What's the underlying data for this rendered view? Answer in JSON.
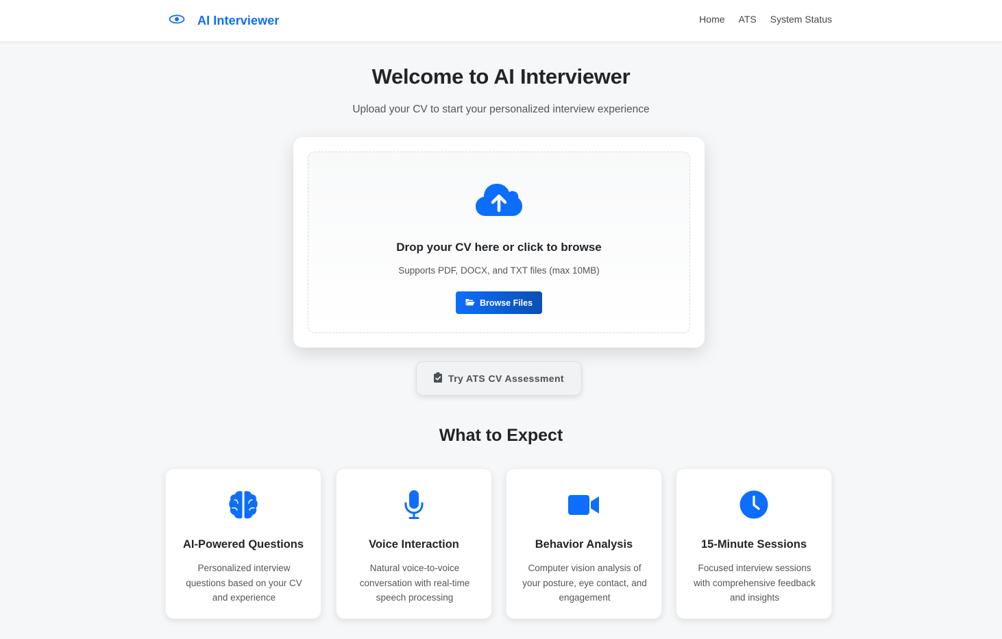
{
  "colors": {
    "accent": "#0d6efd",
    "accent_dark": "#0a4fb4",
    "page_bg": "#f6f7f9"
  },
  "nav": {
    "brand": "AI Interviewer",
    "brand_icon": "eye-icon",
    "links": [
      "Home",
      "ATS",
      "System Status"
    ]
  },
  "hero": {
    "title": "Welcome to AI Interviewer",
    "subtitle": "Upload your CV to start your personalized interview experience"
  },
  "upload": {
    "icon": "cloud-upload-icon",
    "title": "Drop your CV here or click to browse",
    "subtitle": "Supports PDF, DOCX, and TXT files (max 10MB)",
    "button_label": "Browse Files",
    "button_icon": "folder-open-icon"
  },
  "ats_button": {
    "label": "Try ATS CV Assessment",
    "icon": "clipboard-check-icon"
  },
  "features": {
    "title": "What to Expect",
    "items": [
      {
        "icon": "brain-icon",
        "title": "AI-Powered Questions",
        "description": "Personalized interview questions based on your CV and experience"
      },
      {
        "icon": "microphone-icon",
        "title": "Voice Interaction",
        "description": "Natural voice-to-voice conversation with real-time speech processing"
      },
      {
        "icon": "video-camera-icon",
        "title": "Behavior Analysis",
        "description": "Computer vision analysis of your posture, eye contact, and engagement"
      },
      {
        "icon": "clock-icon",
        "title": "15-Minute Sessions",
        "description": "Focused interview sessions with comprehensive feedback and insights"
      }
    ]
  }
}
